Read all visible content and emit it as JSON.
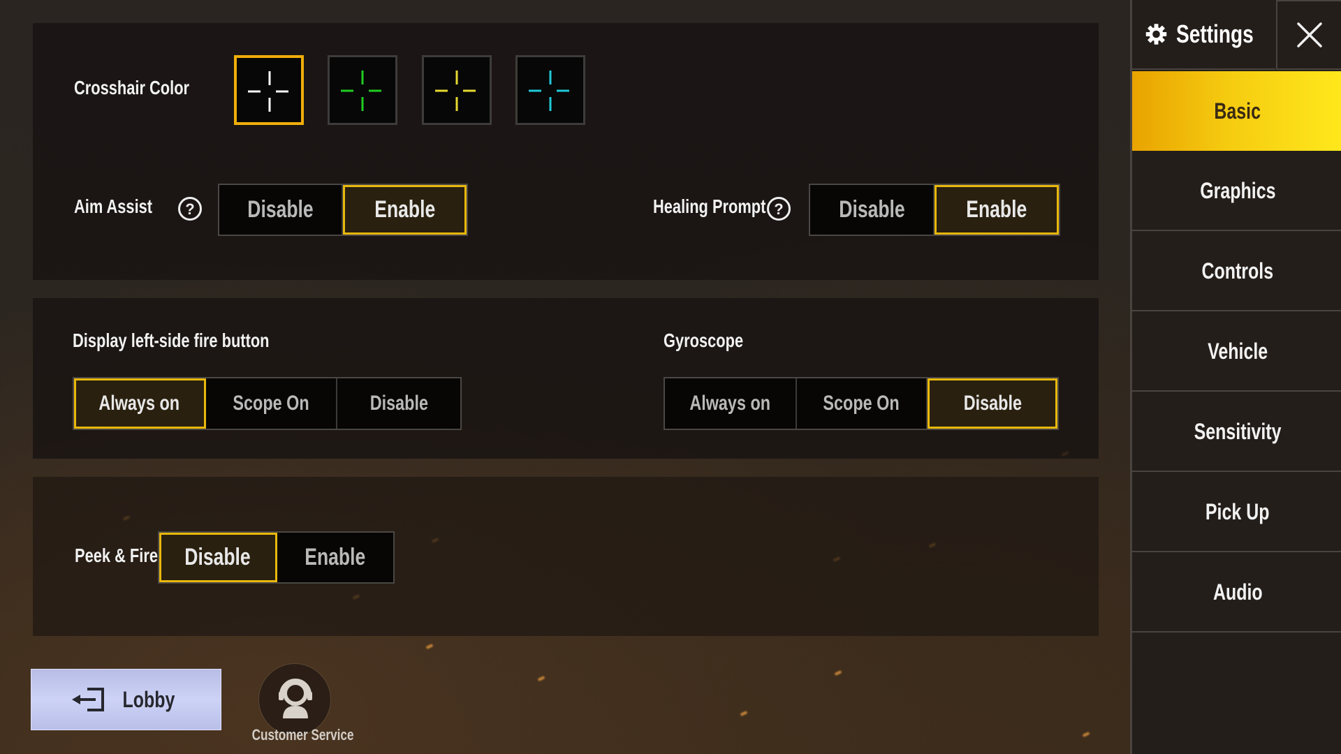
{
  "sidebar": {
    "title": "Settings",
    "icon": "gear-icon",
    "close_icon": "close-icon",
    "items": [
      {
        "label": "Basic",
        "active": true
      },
      {
        "label": "Graphics",
        "active": false
      },
      {
        "label": "Controls",
        "active": false
      },
      {
        "label": "Vehicle",
        "active": false
      },
      {
        "label": "Sensitivity",
        "active": false
      },
      {
        "label": "Pick Up",
        "active": false
      },
      {
        "label": "Audio",
        "active": false
      }
    ]
  },
  "colors": {
    "accent": "#E8B80C",
    "selected_bg": "#2A200F",
    "sidebar_active_start": "#E9A300",
    "sidebar_active_end": "#FFE81C"
  },
  "crosshair": {
    "label": "Crosshair Color",
    "options": [
      {
        "name": "white",
        "color": "#FFFFFF",
        "selected": true
      },
      {
        "name": "green",
        "color": "#22CC22",
        "selected": false
      },
      {
        "name": "yellow",
        "color": "#E6D830",
        "selected": false
      },
      {
        "name": "cyan",
        "color": "#22C8D8",
        "selected": false
      }
    ]
  },
  "aim_assist": {
    "label": "Aim Assist",
    "help_icon": "question-circle-icon",
    "options": [
      "Disable",
      "Enable"
    ],
    "selected": "Enable"
  },
  "healing_prompt": {
    "label": "Healing Prompt",
    "help_icon": "question-circle-icon",
    "options": [
      "Disable",
      "Enable"
    ],
    "selected": "Enable"
  },
  "left_fire_button": {
    "label": "Display left-side fire button",
    "options": [
      "Always on",
      "Scope On",
      "Disable"
    ],
    "selected": "Always on"
  },
  "gyroscope": {
    "label": "Gyroscope",
    "options": [
      "Always on",
      "Scope On",
      "Disable"
    ],
    "selected": "Disable"
  },
  "peek_fire": {
    "label": "Peek & Fire",
    "options": [
      "Disable",
      "Enable"
    ],
    "selected": "Disable"
  },
  "footer": {
    "lobby_label": "Lobby",
    "lobby_icon": "exit-arrow-icon",
    "customer_service_label": "Customer Service",
    "customer_service_icon": "headset-agent-icon"
  }
}
